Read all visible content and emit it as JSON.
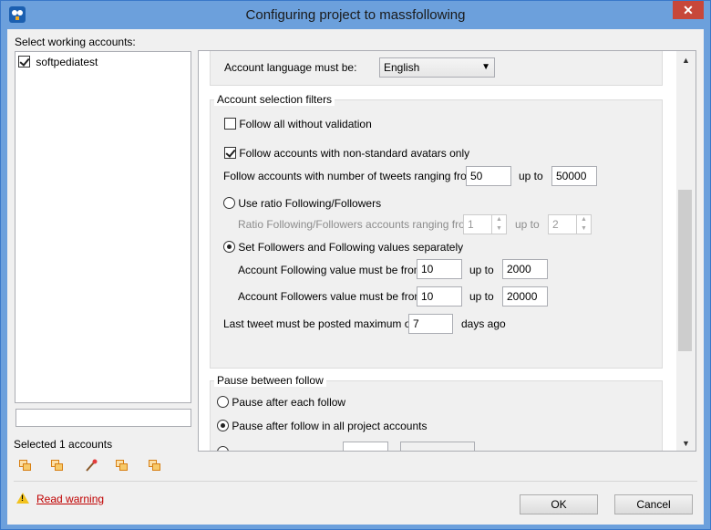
{
  "window": {
    "title": "Configuring project to massfollowing",
    "close_glyph": "✕"
  },
  "accounts": {
    "header": "Select working accounts:",
    "items": [
      {
        "label": "softpediatest",
        "checked": true
      }
    ],
    "filter_value": "",
    "selected_count_text": "Selected 1 accounts"
  },
  "settings": {
    "language_label": "Account language must be:",
    "language_value": "English",
    "filters_group_title": "Account selection filters",
    "follow_all_label": "Follow all without validation",
    "nonstandard_avatars_label": "Follow accounts with non-standard avatars only",
    "tweets_range_label": "Follow accounts with number of tweets ranging from:",
    "tweets_from": "50",
    "tweets_up_to_label": "up to",
    "tweets_to": "50000",
    "use_ratio_label": "Use ratio Following/Followers",
    "ratio_range_label": "Ratio Following/Followers accounts ranging from:",
    "ratio_from": "1",
    "ratio_up_to_label": "up to",
    "ratio_to": "2",
    "separate_values_label": "Set Followers and Following values separately",
    "following_label": "Account Following value must be from:",
    "following_from": "10",
    "following_up_to_label": "up to",
    "following_to": "2000",
    "followers_label": "Account Followers value must be from:",
    "followers_from": "10",
    "followers_up_to_label": "up to",
    "followers_to": "20000",
    "last_tweet_label": "Last tweet must be posted maximum of:",
    "last_tweet_value": "7",
    "last_tweet_unit": "days ago",
    "pause_group_title": "Pause between follow",
    "pause_each_label": "Pause after each follow",
    "pause_all_label": "Pause after follow in all project accounts"
  },
  "footer": {
    "warning_link": "Read warning",
    "ok_label": "OK",
    "cancel_label": "Cancel"
  },
  "colors": {
    "titlebar": "#6ca0dc",
    "close_button": "#c7473a",
    "link": "#c00000"
  }
}
